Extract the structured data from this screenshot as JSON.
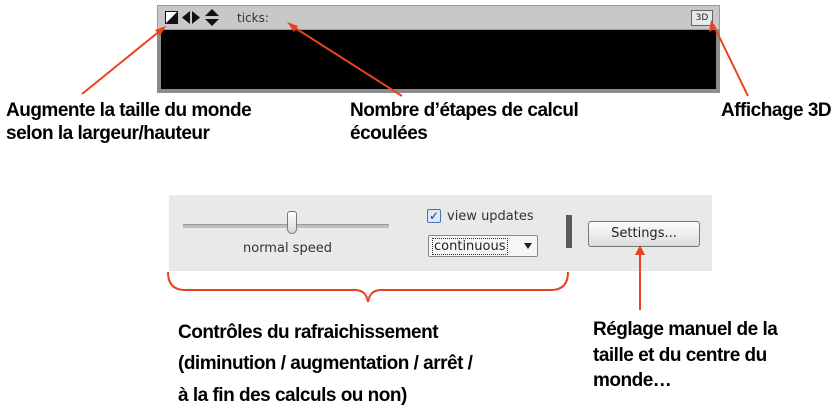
{
  "world_view": {
    "ticks_label": "ticks:",
    "btn_3d_label": "3D"
  },
  "controls": {
    "speed_label": "normal speed",
    "view_updates_label": "view updates",
    "view_updates_checked": true,
    "update_mode_value": "continuous",
    "settings_label": "Settings..."
  },
  "annotations": {
    "resize": [
      "Augmente la taille du monde",
      "selon la largeur/hauteur"
    ],
    "ticks": [
      "Nombre d’étapes de calcul",
      "écoulées"
    ],
    "view3d": [
      "Affichage 3D"
    ],
    "speed": [
      "Contrôles du rafraichissement",
      "(diminution / augmentation / arrêt /",
      "à la fin des calculs ou non)"
    ],
    "settings": [
      "Réglage manuel de la",
      "taille et du centre du",
      "monde…"
    ]
  },
  "colors": {
    "annotation_arrow": "#e8431c",
    "world_background": "#000000"
  }
}
